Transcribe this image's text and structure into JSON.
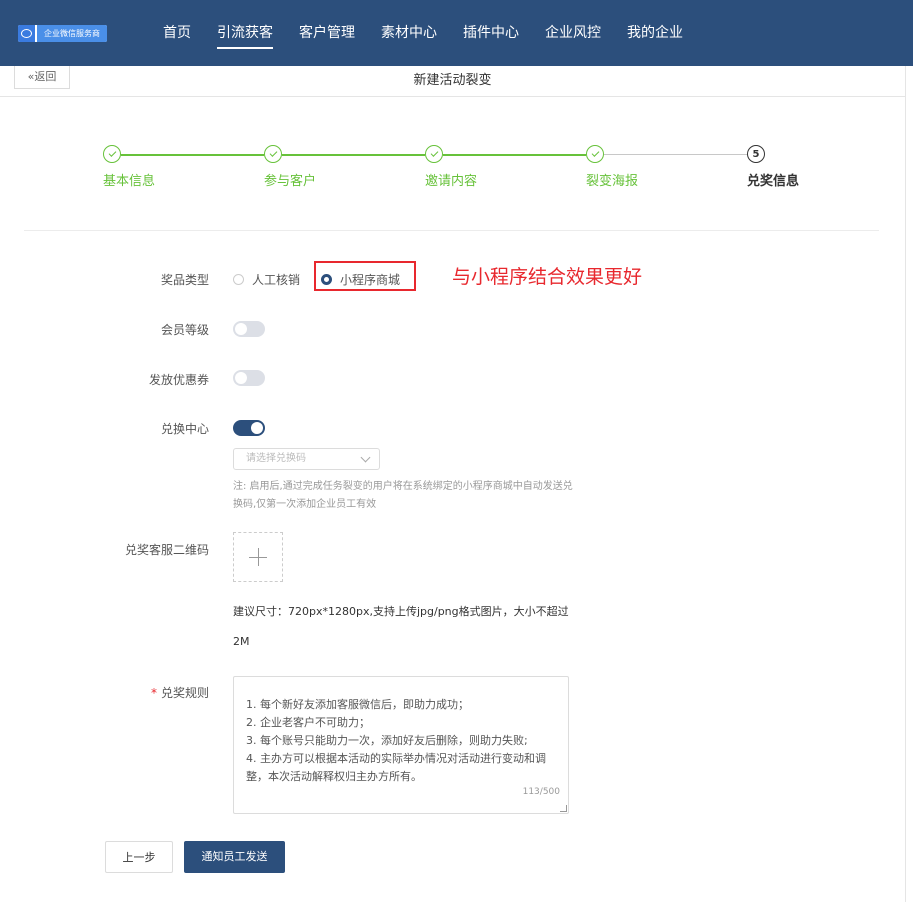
{
  "brand": {
    "logo_text": "企业微信服务商"
  },
  "nav": {
    "items": [
      "首页",
      "引流获客",
      "客户管理",
      "素材中心",
      "插件中心",
      "企业风控",
      "我的企业"
    ],
    "active": "引流获客"
  },
  "subbar": {
    "back_label": "«返回",
    "title": "新建活动裂变"
  },
  "steps": [
    {
      "label": "基本信息",
      "status": "done"
    },
    {
      "label": "参与客户",
      "status": "done"
    },
    {
      "label": "邀请内容",
      "status": "done"
    },
    {
      "label": "裂变海报",
      "status": "done"
    },
    {
      "label": "兑奖信息",
      "status": "current",
      "number": "5"
    }
  ],
  "form": {
    "prize_type": {
      "label": "奖品类型",
      "options": [
        "人工核销",
        "小程序商城"
      ],
      "selected": "小程序商城"
    },
    "annotation": "与小程序结合效果更好",
    "member_level": {
      "label": "会员等级",
      "enabled": false
    },
    "coupon": {
      "label": "发放优惠券",
      "enabled": false
    },
    "exchange_center": {
      "label": "兑换中心",
      "enabled": true,
      "select_placeholder": "请选择兑换码",
      "note": "注: 启用后,通过完成任务裂变的用户将在系统绑定的小程序商城中自动发送兑换码,仅第一次添加企业员工有效"
    },
    "qrcode": {
      "label": "兑奖客服二维码",
      "size_hint": "建议尺寸：720px*1280px,支持上传jpg/png格式图片，大小不超过",
      "size_hint2": "2M"
    },
    "rules": {
      "required_mark": "*",
      "label": "兑奖规则",
      "lines": [
        "1. 每个新好友添加客服微信后，即助力成功；",
        "2. 企业老客户不可助力；",
        "3. 每个账号只能助力一次，添加好友后删除，则助力失败;",
        "4. 主办方可以根据本活动的实际举办情况对活动进行变动和调整，本次活动解释权归主办方所有。"
      ],
      "counter": "113/500"
    }
  },
  "buttons": {
    "prev": "上一步",
    "submit": "通知员工发送"
  },
  "colors": {
    "primary": "#2c4f7c",
    "success": "#67c23a",
    "annotation": "#e8282e"
  }
}
